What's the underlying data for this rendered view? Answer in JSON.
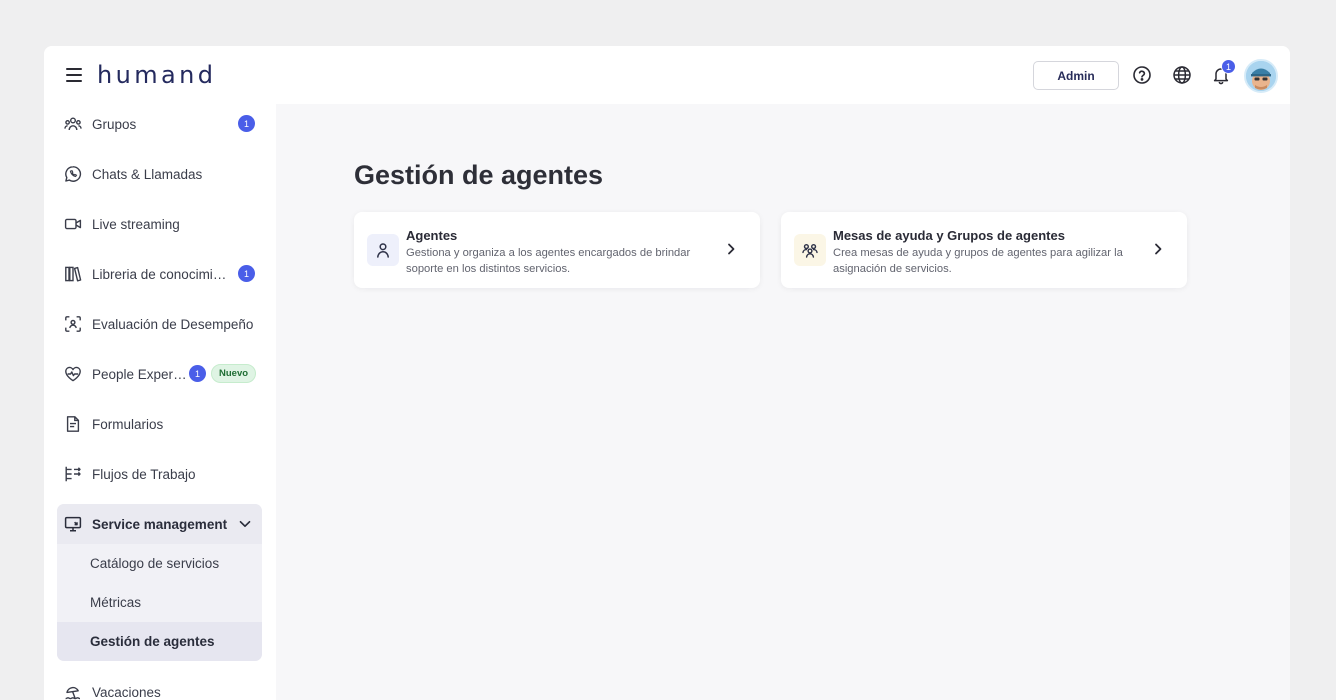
{
  "app": {
    "logo": "humand"
  },
  "header": {
    "admin_label": "Admin",
    "notification_count": "1"
  },
  "sidebar": {
    "items": [
      {
        "label": "Grupos",
        "icon": "users-icon",
        "badge": "1"
      },
      {
        "label": "Chats & Llamadas",
        "icon": "whatsapp-chat-icon"
      },
      {
        "label": "Live streaming",
        "icon": "video-camera-icon"
      },
      {
        "label": "Libreria de conocimie…",
        "icon": "library-books-icon",
        "badge": "1"
      },
      {
        "label": "Evaluación de Desempeño",
        "icon": "focus-person-icon"
      },
      {
        "label": "People Experi…",
        "icon": "heart-pulse-icon",
        "badge": "1",
        "new_badge": "Nuevo"
      },
      {
        "label": "Formularios",
        "icon": "form-document-icon"
      },
      {
        "label": "Flujos de Trabajo",
        "icon": "workflow-icon"
      },
      {
        "label": "Vacaciones",
        "icon": "beach-icon"
      }
    ],
    "service_group": {
      "label": "Service management",
      "icon": "monitor-service-icon",
      "expanded": true,
      "children": [
        {
          "label": "Catálogo de servicios"
        },
        {
          "label": "Métricas"
        },
        {
          "label": "Gestión de agentes",
          "active": true
        }
      ]
    }
  },
  "main": {
    "title": "Gestión de agentes",
    "cards": [
      {
        "title": "Agentes",
        "description": "Gestiona y organiza a los agentes encargados de brindar soporte en los distintos servicios.",
        "icon": "person-icon"
      },
      {
        "title": "Mesas de ayuda y Grupos de agentes",
        "description": "Crea mesas de ayuda y grupos de agentes para agilizar la asignación de servicios.",
        "icon": "group-icon"
      }
    ]
  },
  "colors": {
    "accent": "#4a5ee8",
    "brand": "#242a5e",
    "new_badge_bg": "#dff4e4",
    "new_badge_text": "#1f6e34"
  }
}
